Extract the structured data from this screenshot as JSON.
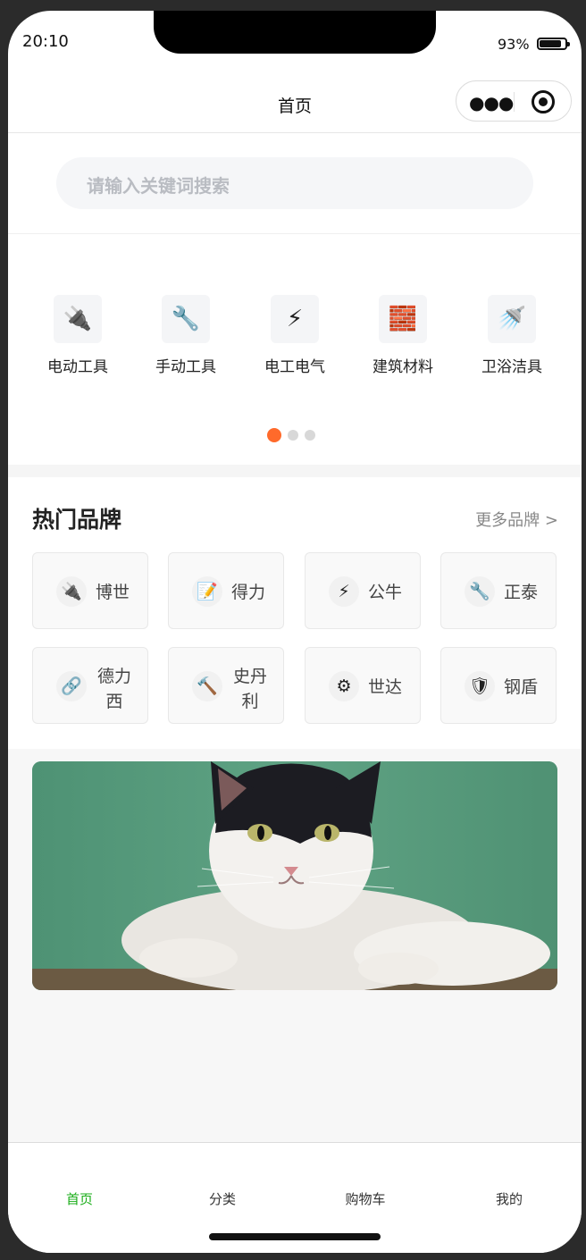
{
  "status": {
    "time": "20:10",
    "battery": "93%",
    "battery_level": 0.93
  },
  "nav": {
    "title": "首页"
  },
  "search": {
    "placeholder": "请输入关键词搜索"
  },
  "categories": [
    {
      "icon": "plug-icon",
      "glyph": "🔌",
      "label": "电动工具"
    },
    {
      "icon": "wrench-icon",
      "glyph": "🔧",
      "label": "手动工具"
    },
    {
      "icon": "lightning-icon",
      "glyph": "⚡",
      "label": "电工电气"
    },
    {
      "icon": "bricks-icon",
      "glyph": "🧱",
      "label": "建筑材料"
    },
    {
      "icon": "shower-icon",
      "glyph": "🚿",
      "label": "卫浴洁具"
    }
  ],
  "carousel": {
    "pages": 3,
    "active": 1
  },
  "hot_brands": {
    "title": "热门品牌",
    "more": "更多品牌 >",
    "items": [
      {
        "icon": "plug-icon",
        "glyph": "🔌",
        "name": "博世"
      },
      {
        "icon": "memo-icon",
        "glyph": "📝",
        "name": "得力"
      },
      {
        "icon": "lightning-icon",
        "glyph": "⚡",
        "name": "公牛"
      },
      {
        "icon": "wrench-icon",
        "glyph": "🔧",
        "name": "正泰"
      },
      {
        "icon": "link-icon",
        "glyph": "🔗",
        "name": "德力西"
      },
      {
        "icon": "hammer-icon",
        "glyph": "🔨",
        "name": "史丹利"
      },
      {
        "icon": "gear-icon",
        "glyph": "⚙",
        "name": "世达"
      },
      {
        "icon": "shield-icon",
        "glyph": "🛡",
        "name": "钢盾"
      }
    ]
  },
  "banner": {
    "image": "cat-photo"
  },
  "tabbar": {
    "items": [
      "首页",
      "分类",
      "购物车",
      "我的"
    ],
    "active": 0
  },
  "colors": {
    "accent": "#ff6a2b",
    "tab_active": "#1aad19",
    "banner_bg": "#5a9a7e"
  }
}
